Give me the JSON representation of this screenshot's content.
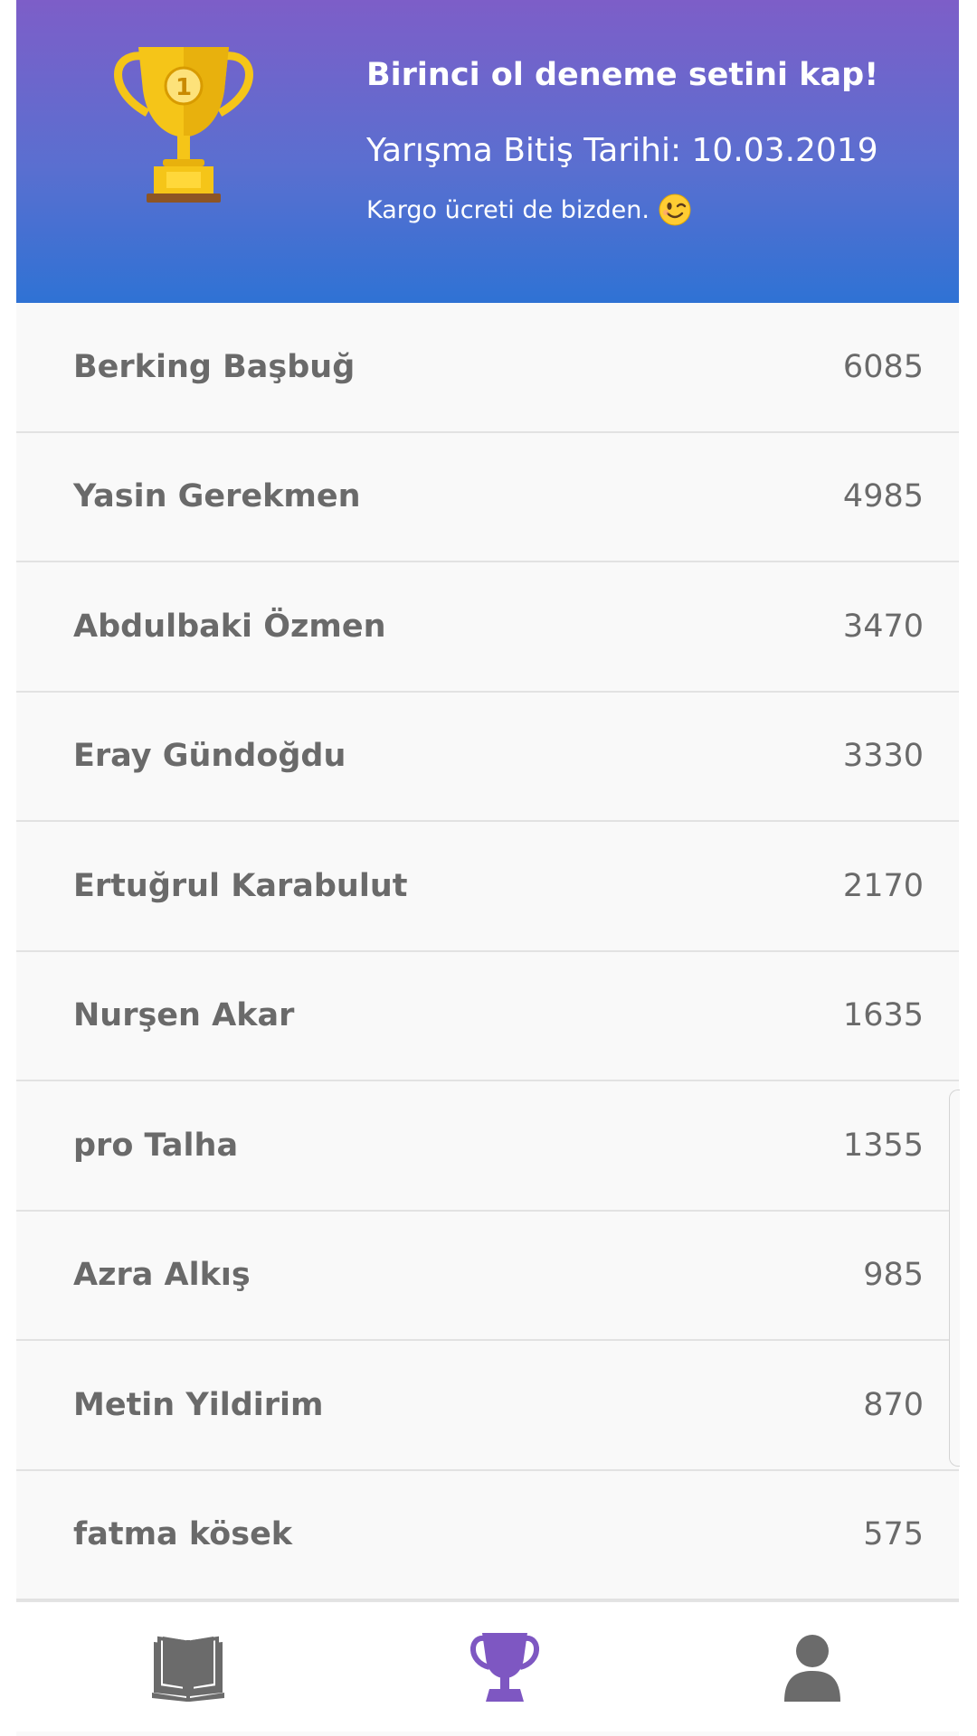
{
  "header": {
    "title": "Birinci ol deneme setini kap!",
    "date": "Yarışma Bitiş Tarihi: 10.03.2019",
    "note": "Kargo ücreti de bizden.",
    "trophy_icon": "gold-trophy-icon",
    "emoji_icon": "winking-face-icon",
    "gradient_top": "#7d5ec8",
    "gradient_bottom": "#2f72d4"
  },
  "leaderboard": [
    {
      "name": "Berking Başbuğ",
      "score": "6085"
    },
    {
      "name": "Yasin Gerekmen",
      "score": "4985"
    },
    {
      "name": "Abdulbaki Özmen",
      "score": "3470"
    },
    {
      "name": "Eray Gündoğdu",
      "score": "3330"
    },
    {
      "name": "Ertuğrul Karabulut",
      "score": "2170"
    },
    {
      "name": "Nurşen Akar",
      "score": "1635"
    },
    {
      "name": "pro Talha",
      "score": "1355"
    },
    {
      "name": "Azra Alkış",
      "score": "985"
    },
    {
      "name": "Metin Yildirim",
      "score": "870"
    },
    {
      "name": "fatma kösek",
      "score": "575"
    }
  ],
  "bottom_nav": {
    "items": [
      {
        "icon": "book-icon",
        "active": false
      },
      {
        "icon": "trophy-icon",
        "active": true
      },
      {
        "icon": "user-icon",
        "active": false
      }
    ],
    "active_color": "#7e57c2",
    "inactive_color": "#6b6b6b"
  }
}
